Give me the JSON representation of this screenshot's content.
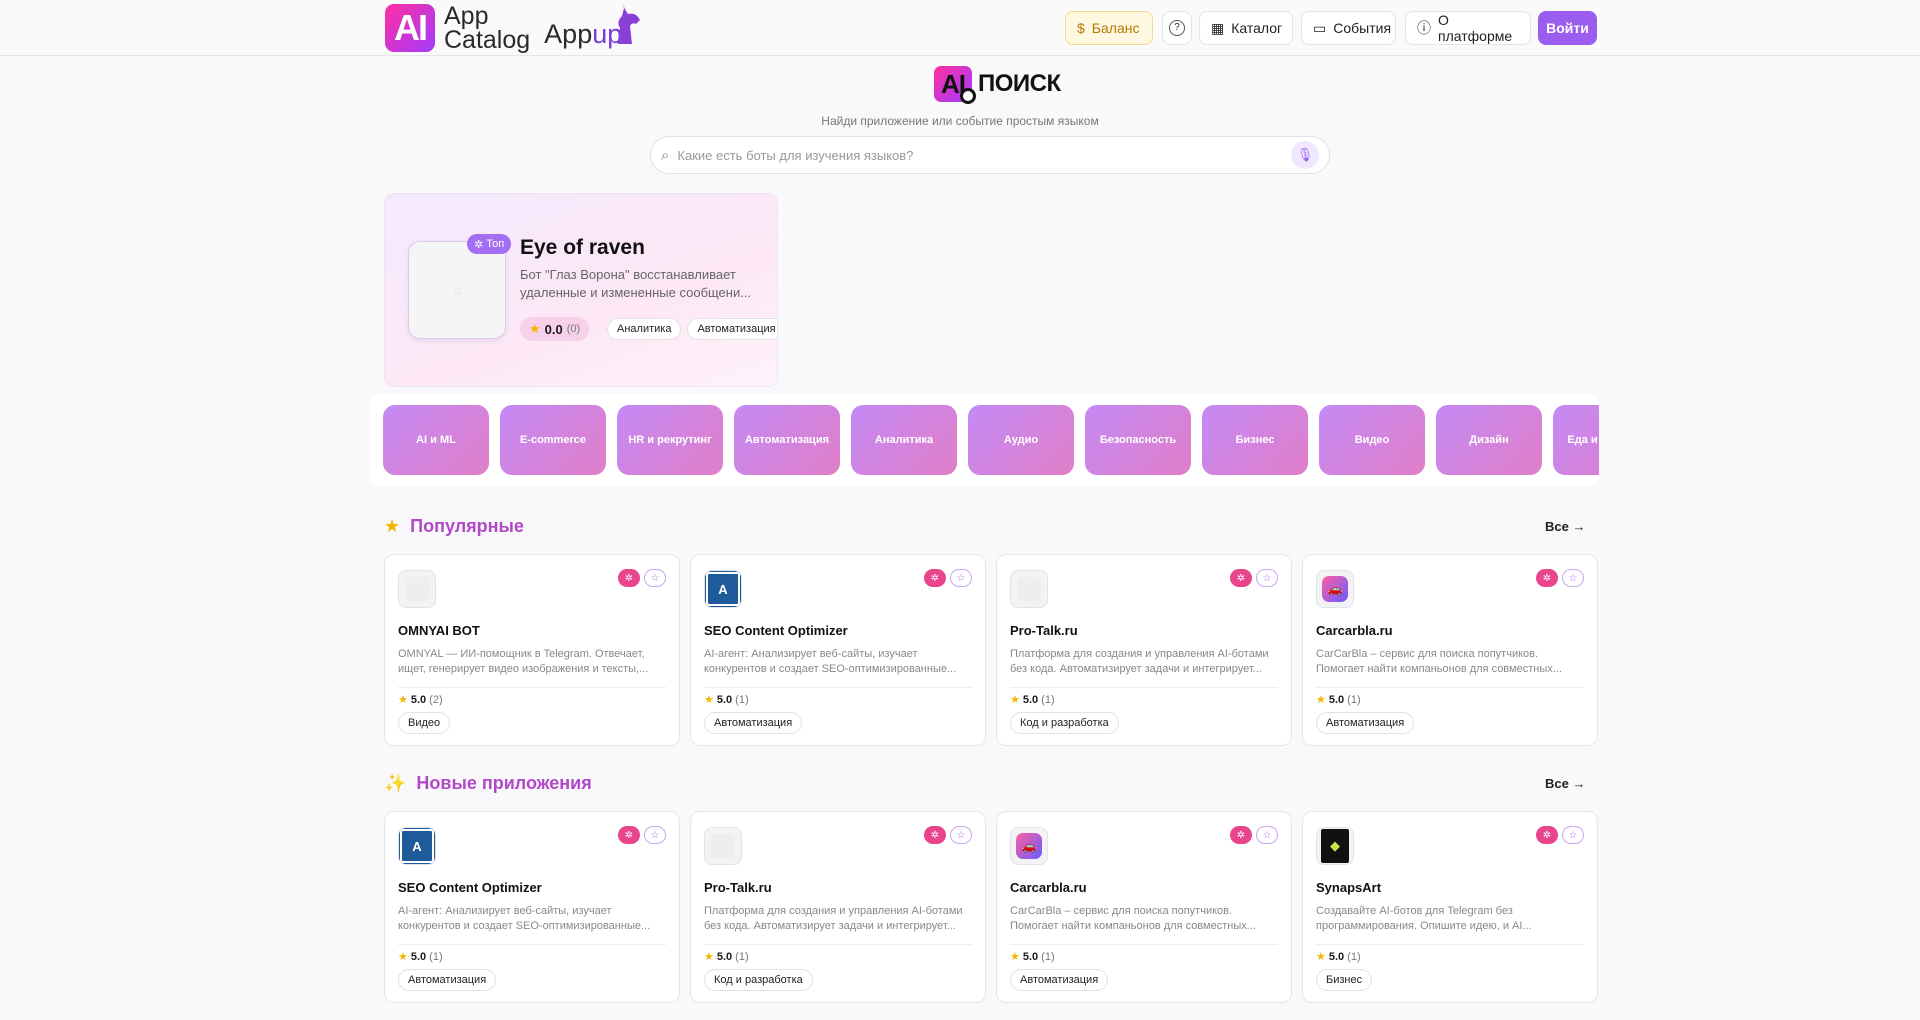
{
  "header": {
    "logo_ai": "AI",
    "logo_app": "App",
    "logo_catalog": "Catalog",
    "logo_appup_app": "App",
    "logo_appup_up": "up",
    "balance": "Баланс",
    "help_icon": "?",
    "catalog": "Каталог",
    "events": "События",
    "about": "О платформе",
    "login": "Войти"
  },
  "search": {
    "logo_ai": "AI",
    "logo_text": "ПОИСК",
    "subtitle": "Найди приложение или событие простым языком",
    "placeholder": "Какие есть боты для изучения языков?"
  },
  "featured": {
    "badge": "Топ",
    "title": "Eye of raven",
    "description": "Бот \"Глаз Ворона\" восстанавливает удаленные и измененные сообщени...",
    "rating": "0.0",
    "rating_count": "(0)",
    "tags": [
      "Аналитика",
      "Автоматизация"
    ]
  },
  "categories": [
    "AI и ML",
    "E-commerce",
    "HR и рекрутинг",
    "Автоматизация",
    "Аналитика",
    "Аудио",
    "Безопасность",
    "Бизнес",
    "Видео",
    "Дизайн",
    "Еда и напитки"
  ],
  "popular": {
    "title": "Популярные",
    "all": "Все",
    "cards": [
      {
        "name": "OMNYAI BOT",
        "desc": "OMNYAL — ИИ-помощник в Telegram. Отвечает, ищет, генерирует видео изображения и тексты,...",
        "rating": "5.0",
        "count": "(2)",
        "tag": "Видео",
        "icon": "placeholder-icon"
      },
      {
        "name": "SEO Content Optimizer",
        "desc": "AI-агент: Анализирует веб-сайты, изучает конкурентов и создает SEO-оптимизированные...",
        "rating": "5.0",
        "count": "(1)",
        "tag": "Автоматизация",
        "icon": "seo-logo-icon"
      },
      {
        "name": "Pro-Talk.ru",
        "desc": "Платформа для создания и управления AI-ботами без кода. Автоматизирует задачи и интегрирует...",
        "rating": "5.0",
        "count": "(1)",
        "tag": "Код и разработка",
        "icon": "placeholder-icon"
      },
      {
        "name": "Carcarbla.ru",
        "desc": "CarCarBla – сервис для поиска попутчиков. Помогает найти компаньонов для совместных...",
        "rating": "5.0",
        "count": "(1)",
        "tag": "Автоматизация",
        "icon": "car-logo-icon"
      }
    ]
  },
  "new_apps": {
    "title": "Новые приложения",
    "all": "Все",
    "cards": [
      {
        "name": "SEO Content Optimizer",
        "desc": "AI-агент: Анализирует веб-сайты, изучает конкурентов и создает SEO-оптимизированные...",
        "rating": "5.0",
        "count": "(1)",
        "tag": "Автоматизация",
        "icon": "seo-logo-icon"
      },
      {
        "name": "Pro-Talk.ru",
        "desc": "Платформа для создания и управления AI-ботами без кода. Автоматизирует задачи и интегрирует...",
        "rating": "5.0",
        "count": "(1)",
        "tag": "Код и разработка",
        "icon": "placeholder-icon"
      },
      {
        "name": "Carcarbla.ru",
        "desc": "CarCarBla – сервис для поиска попутчиков. Помогает найти компаньонов для совместных...",
        "rating": "5.0",
        "count": "(1)",
        "tag": "Автоматизация",
        "icon": "car-logo-icon"
      },
      {
        "name": "SynapsArt",
        "desc": "Создавайте AI-ботов для Telegram без программирования. Опишите идею, и AI...",
        "rating": "5.0",
        "count": "(1)",
        "tag": "Бизнес",
        "icon": "synapsart-logo-icon"
      }
    ]
  },
  "colors": {
    "accent": "#9b5cf0",
    "pink": "#e8458c",
    "section_title": "#b048c8"
  }
}
